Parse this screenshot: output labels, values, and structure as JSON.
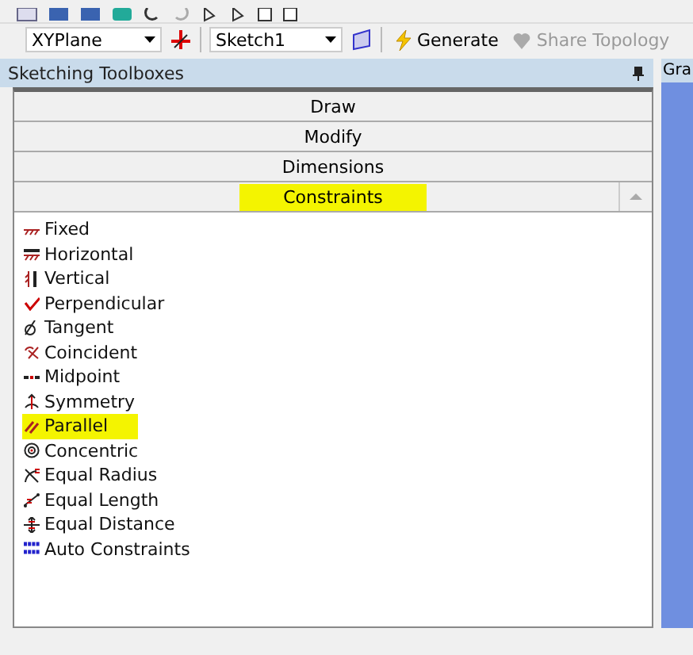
{
  "toolbar": {
    "plane": "XYPlane",
    "sketch": "Sketch1",
    "buttons": [
      {
        "label": "Generate",
        "disabled": false
      },
      {
        "label": "Share Topology",
        "disabled": true
      }
    ]
  },
  "panel": {
    "title": "Sketching Toolboxes",
    "side_tab": "Gra"
  },
  "sections": [
    {
      "label": "Draw",
      "expanded": false,
      "highlighted": false
    },
    {
      "label": "Modify",
      "expanded": false,
      "highlighted": false
    },
    {
      "label": "Dimensions",
      "expanded": false,
      "highlighted": false
    },
    {
      "label": "Constraints",
      "expanded": true,
      "highlighted": true
    }
  ],
  "items": [
    {
      "label": "Fixed",
      "highlighted": false
    },
    {
      "label": "Horizontal",
      "highlighted": false
    },
    {
      "label": "Vertical",
      "highlighted": false
    },
    {
      "label": "Perpendicular",
      "highlighted": false
    },
    {
      "label": "Tangent",
      "highlighted": false
    },
    {
      "label": "Coincident",
      "highlighted": false
    },
    {
      "label": "Midpoint",
      "highlighted": false
    },
    {
      "label": "Symmetry",
      "highlighted": false
    },
    {
      "label": "Parallel",
      "highlighted": true
    },
    {
      "label": "Concentric",
      "highlighted": false
    },
    {
      "label": "Equal Radius",
      "highlighted": false
    },
    {
      "label": "Equal Length",
      "highlighted": false
    },
    {
      "label": "Equal Distance",
      "highlighted": false
    },
    {
      "label": "Auto Constraints",
      "highlighted": false
    }
  ]
}
